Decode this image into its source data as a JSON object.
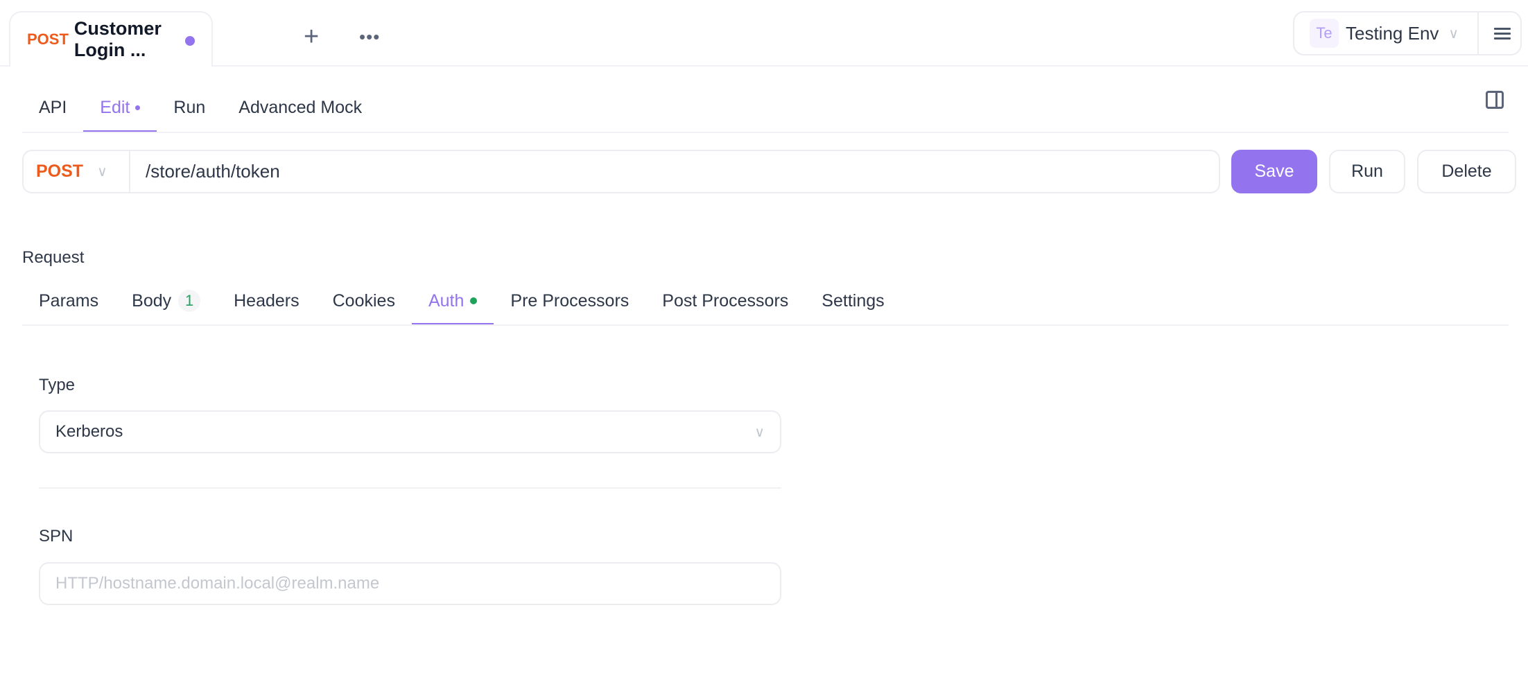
{
  "file_tab": {
    "method": "POST",
    "title": "Customer Login ...",
    "unsaved": true
  },
  "toolbar": {
    "add_icon": "plus-icon",
    "more_icon": "ellipsis-icon"
  },
  "environment": {
    "badge": "Te",
    "name": "Testing Env"
  },
  "main_tabs": [
    {
      "label": "API"
    },
    {
      "label": "Edit",
      "active": true,
      "modified": true
    },
    {
      "label": "Run"
    },
    {
      "label": "Advanced Mock"
    }
  ],
  "url_bar": {
    "method": "POST",
    "path": "/store/auth/token"
  },
  "actions": {
    "save": "Save",
    "run": "Run",
    "delete": "Delete"
  },
  "request": {
    "label": "Request",
    "tabs": [
      {
        "label": "Params"
      },
      {
        "label": "Body",
        "badge": "1"
      },
      {
        "label": "Headers"
      },
      {
        "label": "Cookies"
      },
      {
        "label": "Auth",
        "active": true
      },
      {
        "label": "Pre Processors"
      },
      {
        "label": "Post Processors"
      },
      {
        "label": "Settings"
      }
    ]
  },
  "auth": {
    "type_label": "Type",
    "type_value": "Kerberos",
    "spn_label": "SPN",
    "spn_value": "",
    "spn_placeholder": "HTTP/hostname.domain.local@realm.name"
  },
  "colors": {
    "accent": "#9373ee",
    "method_post": "#ec5b1c",
    "status_green": "#1fa35c"
  }
}
